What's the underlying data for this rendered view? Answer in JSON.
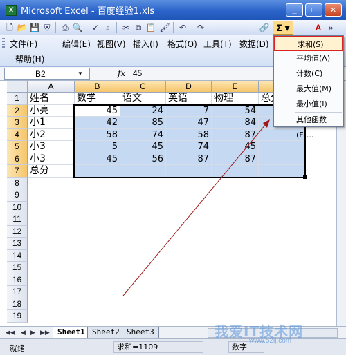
{
  "window": {
    "title": "Microsoft Excel - 百度经验1.xls"
  },
  "menu": {
    "file": "文件(F)",
    "edit": "编辑(E)",
    "view": "视图(V)",
    "insert": "插入(I)",
    "format": "格式(O)",
    "tools": "工具(T)",
    "data": "数据(D)",
    "help": "帮助(H)"
  },
  "formula_bar": {
    "name_box": "B2",
    "fx": "fx",
    "value": "45"
  },
  "columns": [
    "A",
    "B",
    "C",
    "D",
    "E"
  ],
  "rows": [
    "1",
    "2",
    "3",
    "4",
    "5",
    "6",
    "7",
    "8",
    "9",
    "10",
    "11",
    "12",
    "13",
    "14",
    "15",
    "16",
    "17",
    "18",
    "19"
  ],
  "table": {
    "headers": [
      "姓名",
      "数学",
      "语文",
      "英语",
      "物理",
      "总分"
    ],
    "records": [
      {
        "name": "小亮",
        "values": [
          "45",
          "24",
          "7",
          "54"
        ]
      },
      {
        "name": "小1",
        "values": [
          "42",
          "85",
          "47",
          "84"
        ]
      },
      {
        "name": "小2",
        "values": [
          "58",
          "74",
          "58",
          "87"
        ]
      },
      {
        "name": "小3",
        "values": [
          "5",
          "45",
          "74",
          "45"
        ]
      },
      {
        "name": "小3",
        "values": [
          "45",
          "56",
          "87",
          "87"
        ]
      }
    ],
    "total_label": "总分"
  },
  "autosum_menu": {
    "items": [
      "求和(S)",
      "平均值(A)",
      "计数(C)",
      "最大值(M)",
      "最小值(I)",
      "其他函数(F)..."
    ]
  },
  "sheets": [
    "Sheet1",
    "Sheet2",
    "Sheet3"
  ],
  "status": {
    "ready": "就绪",
    "sum": "求和=1109",
    "num": "数字"
  },
  "watermark": {
    "text": "我爱IT技术网",
    "url": "www.52ij.com"
  },
  "colors": {
    "selection": "#c5d9f3",
    "highlight_header": "#f5c56a",
    "menu_active_border": "#dd2222"
  }
}
